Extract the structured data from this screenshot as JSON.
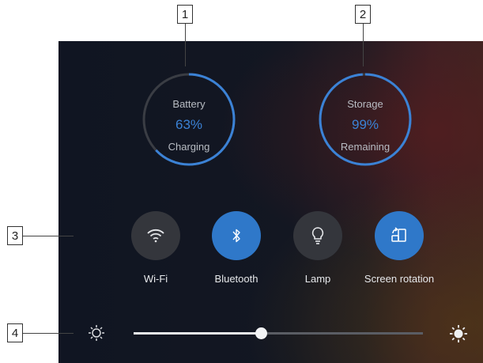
{
  "callouts": [
    "1",
    "2",
    "3",
    "4"
  ],
  "battery": {
    "title": "Battery",
    "value": "63%",
    "status": "Charging",
    "level": 0.63
  },
  "storage": {
    "title": "Storage",
    "value": "99%",
    "status": "Remaining",
    "level": 0.99
  },
  "toggles": [
    {
      "label": "Wi-Fi",
      "state": "off",
      "icon": "wifi-icon"
    },
    {
      "label": "Bluetooth",
      "state": "on",
      "icon": "bluetooth-icon"
    },
    {
      "label": "Lamp",
      "state": "off",
      "icon": "lamp-icon"
    },
    {
      "label": "Screen rotation",
      "state": "on",
      "icon": "screen-rotation-icon"
    }
  ],
  "brightness": {
    "level": 0.44,
    "low_icon": "brightness-low-icon",
    "high_icon": "brightness-high-icon"
  },
  "colors": {
    "accent": "#2f78c9",
    "gauge_track": "#3a3d44",
    "toggle_off": "#34363c"
  }
}
